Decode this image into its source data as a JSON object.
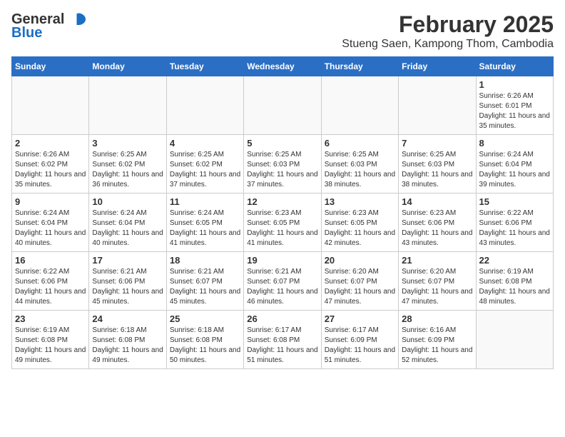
{
  "header": {
    "logo_general": "General",
    "logo_blue": "Blue",
    "month": "February 2025",
    "location": "Stueng Saen, Kampong Thom, Cambodia"
  },
  "weekdays": [
    "Sunday",
    "Monday",
    "Tuesday",
    "Wednesday",
    "Thursday",
    "Friday",
    "Saturday"
  ],
  "weeks": [
    [
      {
        "day": "",
        "sunrise": "",
        "sunset": "",
        "daylight": ""
      },
      {
        "day": "",
        "sunrise": "",
        "sunset": "",
        "daylight": ""
      },
      {
        "day": "",
        "sunrise": "",
        "sunset": "",
        "daylight": ""
      },
      {
        "day": "",
        "sunrise": "",
        "sunset": "",
        "daylight": ""
      },
      {
        "day": "",
        "sunrise": "",
        "sunset": "",
        "daylight": ""
      },
      {
        "day": "",
        "sunrise": "",
        "sunset": "",
        "daylight": ""
      },
      {
        "day": "1",
        "sunrise": "Sunrise: 6:26 AM",
        "sunset": "Sunset: 6:01 PM",
        "daylight": "Daylight: 11 hours and 35 minutes."
      }
    ],
    [
      {
        "day": "2",
        "sunrise": "Sunrise: 6:26 AM",
        "sunset": "Sunset: 6:02 PM",
        "daylight": "Daylight: 11 hours and 35 minutes."
      },
      {
        "day": "3",
        "sunrise": "Sunrise: 6:25 AM",
        "sunset": "Sunset: 6:02 PM",
        "daylight": "Daylight: 11 hours and 36 minutes."
      },
      {
        "day": "4",
        "sunrise": "Sunrise: 6:25 AM",
        "sunset": "Sunset: 6:02 PM",
        "daylight": "Daylight: 11 hours and 37 minutes."
      },
      {
        "day": "5",
        "sunrise": "Sunrise: 6:25 AM",
        "sunset": "Sunset: 6:03 PM",
        "daylight": "Daylight: 11 hours and 37 minutes."
      },
      {
        "day": "6",
        "sunrise": "Sunrise: 6:25 AM",
        "sunset": "Sunset: 6:03 PM",
        "daylight": "Daylight: 11 hours and 38 minutes."
      },
      {
        "day": "7",
        "sunrise": "Sunrise: 6:25 AM",
        "sunset": "Sunset: 6:03 PM",
        "daylight": "Daylight: 11 hours and 38 minutes."
      },
      {
        "day": "8",
        "sunrise": "Sunrise: 6:24 AM",
        "sunset": "Sunset: 6:04 PM",
        "daylight": "Daylight: 11 hours and 39 minutes."
      }
    ],
    [
      {
        "day": "9",
        "sunrise": "Sunrise: 6:24 AM",
        "sunset": "Sunset: 6:04 PM",
        "daylight": "Daylight: 11 hours and 40 minutes."
      },
      {
        "day": "10",
        "sunrise": "Sunrise: 6:24 AM",
        "sunset": "Sunset: 6:04 PM",
        "daylight": "Daylight: 11 hours and 40 minutes."
      },
      {
        "day": "11",
        "sunrise": "Sunrise: 6:24 AM",
        "sunset": "Sunset: 6:05 PM",
        "daylight": "Daylight: 11 hours and 41 minutes."
      },
      {
        "day": "12",
        "sunrise": "Sunrise: 6:23 AM",
        "sunset": "Sunset: 6:05 PM",
        "daylight": "Daylight: 11 hours and 41 minutes."
      },
      {
        "day": "13",
        "sunrise": "Sunrise: 6:23 AM",
        "sunset": "Sunset: 6:05 PM",
        "daylight": "Daylight: 11 hours and 42 minutes."
      },
      {
        "day": "14",
        "sunrise": "Sunrise: 6:23 AM",
        "sunset": "Sunset: 6:06 PM",
        "daylight": "Daylight: 11 hours and 43 minutes."
      },
      {
        "day": "15",
        "sunrise": "Sunrise: 6:22 AM",
        "sunset": "Sunset: 6:06 PM",
        "daylight": "Daylight: 11 hours and 43 minutes."
      }
    ],
    [
      {
        "day": "16",
        "sunrise": "Sunrise: 6:22 AM",
        "sunset": "Sunset: 6:06 PM",
        "daylight": "Daylight: 11 hours and 44 minutes."
      },
      {
        "day": "17",
        "sunrise": "Sunrise: 6:21 AM",
        "sunset": "Sunset: 6:06 PM",
        "daylight": "Daylight: 11 hours and 45 minutes."
      },
      {
        "day": "18",
        "sunrise": "Sunrise: 6:21 AM",
        "sunset": "Sunset: 6:07 PM",
        "daylight": "Daylight: 11 hours and 45 minutes."
      },
      {
        "day": "19",
        "sunrise": "Sunrise: 6:21 AM",
        "sunset": "Sunset: 6:07 PM",
        "daylight": "Daylight: 11 hours and 46 minutes."
      },
      {
        "day": "20",
        "sunrise": "Sunrise: 6:20 AM",
        "sunset": "Sunset: 6:07 PM",
        "daylight": "Daylight: 11 hours and 47 minutes."
      },
      {
        "day": "21",
        "sunrise": "Sunrise: 6:20 AM",
        "sunset": "Sunset: 6:07 PM",
        "daylight": "Daylight: 11 hours and 47 minutes."
      },
      {
        "day": "22",
        "sunrise": "Sunrise: 6:19 AM",
        "sunset": "Sunset: 6:08 PM",
        "daylight": "Daylight: 11 hours and 48 minutes."
      }
    ],
    [
      {
        "day": "23",
        "sunrise": "Sunrise: 6:19 AM",
        "sunset": "Sunset: 6:08 PM",
        "daylight": "Daylight: 11 hours and 49 minutes."
      },
      {
        "day": "24",
        "sunrise": "Sunrise: 6:18 AM",
        "sunset": "Sunset: 6:08 PM",
        "daylight": "Daylight: 11 hours and 49 minutes."
      },
      {
        "day": "25",
        "sunrise": "Sunrise: 6:18 AM",
        "sunset": "Sunset: 6:08 PM",
        "daylight": "Daylight: 11 hours and 50 minutes."
      },
      {
        "day": "26",
        "sunrise": "Sunrise: 6:17 AM",
        "sunset": "Sunset: 6:08 PM",
        "daylight": "Daylight: 11 hours and 51 minutes."
      },
      {
        "day": "27",
        "sunrise": "Sunrise: 6:17 AM",
        "sunset": "Sunset: 6:09 PM",
        "daylight": "Daylight: 11 hours and 51 minutes."
      },
      {
        "day": "28",
        "sunrise": "Sunrise: 6:16 AM",
        "sunset": "Sunset: 6:09 PM",
        "daylight": "Daylight: 11 hours and 52 minutes."
      },
      {
        "day": "",
        "sunrise": "",
        "sunset": "",
        "daylight": ""
      }
    ]
  ]
}
